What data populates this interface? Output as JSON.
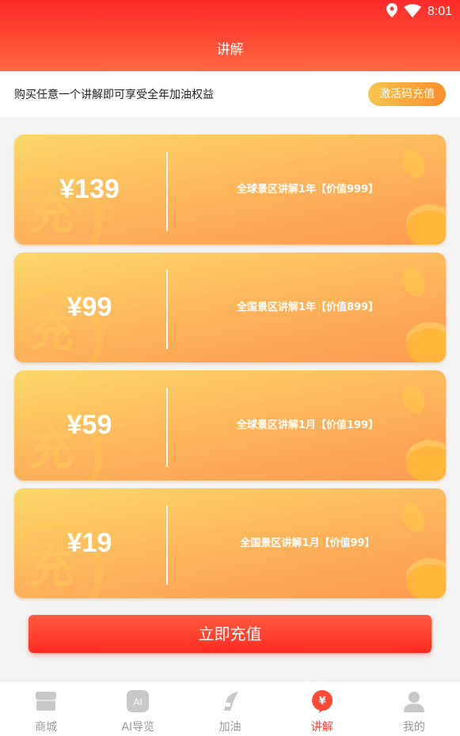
{
  "status_bar": {
    "time": "8:01"
  },
  "header": {
    "title": "讲解"
  },
  "notice": {
    "text": "购买任意一个讲解即可享受全年加油权益",
    "activate_label": "激活码充值"
  },
  "plans": [
    {
      "price": "¥139",
      "desc": "全球景区讲解1年【价值999】"
    },
    {
      "price": "¥99",
      "desc": "全国景区讲解1年【价值899】"
    },
    {
      "price": "¥59",
      "desc": "全球景区讲解1月【价值199】"
    },
    {
      "price": "¥19",
      "desc": "全国景区讲解1月【价值99】"
    }
  ],
  "recharge_label": "立即充值",
  "tabs": [
    {
      "label": "商城",
      "icon": "shop-icon"
    },
    {
      "label": "AI导览",
      "icon": "ai-icon"
    },
    {
      "label": "加油",
      "icon": "fuel-icon"
    },
    {
      "label": "讲解",
      "icon": "yuan-badge-icon",
      "active": true
    },
    {
      "label": "我的",
      "icon": "user-icon"
    }
  ],
  "colors": {
    "accent_red": "#ff3b2f",
    "header_red": "#ff2a2a",
    "card_orange": "#fdb85c",
    "activate_orange": "#fb8d2c"
  }
}
